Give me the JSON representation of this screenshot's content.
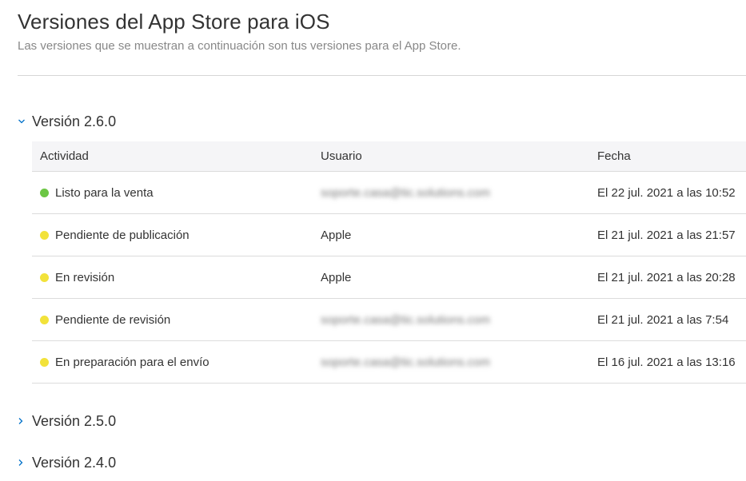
{
  "header": {
    "title": "Versiones del App Store para iOS",
    "subtitle": "Las versiones que se muestran a continuación son tus versiones para el App Store."
  },
  "versions": [
    {
      "label": "Versión 2.6.0",
      "expanded": true,
      "chevron_icon": "chevron-down-icon"
    },
    {
      "label": "Versión 2.5.0",
      "expanded": false,
      "chevron_icon": "chevron-right-icon"
    },
    {
      "label": "Versión 2.4.0",
      "expanded": false,
      "chevron_icon": "chevron-right-icon"
    }
  ],
  "table": {
    "columns": [
      "Actividad",
      "Usuario",
      "Fecha"
    ],
    "rows": [
      {
        "status_color": "#6cc644",
        "activity": "Listo para la venta",
        "user": "soporte.casa@tic.solutions.com",
        "user_blurred": true,
        "date": "El 22 jul. 2021 a las 10:52"
      },
      {
        "status_color": "#f2e23a",
        "activity": "Pendiente de publicación",
        "user": "Apple",
        "user_blurred": false,
        "date": "El 21 jul. 2021 a las 21:57"
      },
      {
        "status_color": "#f2e23a",
        "activity": "En revisión",
        "user": "Apple",
        "user_blurred": false,
        "date": "El 21 jul. 2021 a las 20:28"
      },
      {
        "status_color": "#f2e23a",
        "activity": "Pendiente de revisión",
        "user": "soporte.casa@tic.solutions.com",
        "user_blurred": true,
        "date": "El 21 jul. 2021 a las 7:54"
      },
      {
        "status_color": "#f2e23a",
        "activity": "En preparación para el envío",
        "user": "soporte.casa@tic.solutions.com",
        "user_blurred": true,
        "date": "El 16 jul. 2021 a las 13:16"
      }
    ]
  },
  "colors": {
    "accent": "#0070c9",
    "ready": "#6cc644",
    "pending": "#f2e23a"
  }
}
